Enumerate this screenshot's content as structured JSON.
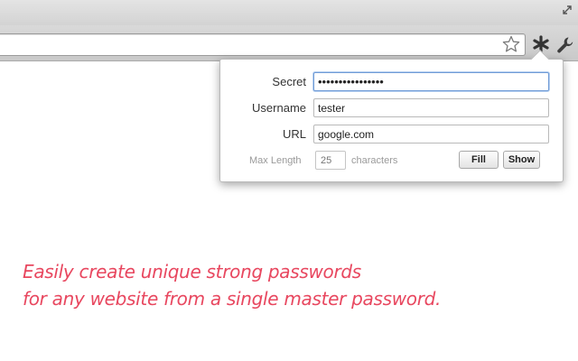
{
  "browser": {
    "address_value": "",
    "star_icon": "bookmark-star-icon",
    "extension_icon": "asterisk-extension-icon",
    "wrench_icon": "wrench-settings-icon",
    "resize_icon": "resize-diagonal-icon"
  },
  "popup": {
    "secret": {
      "label": "Secret",
      "value": "••••••••••••••••"
    },
    "username": {
      "label": "Username",
      "value": "tester"
    },
    "url": {
      "label": "URL",
      "value": "google.com"
    },
    "max_length": {
      "label": "Max Length",
      "placeholder": "25",
      "suffix": "characters"
    },
    "buttons": {
      "fill": "Fill",
      "show": "Show"
    }
  },
  "tagline": {
    "line1": "Easily create unique strong passwords",
    "line2": "for any website from a single master password."
  },
  "colors": {
    "tagline": "#e8475f",
    "focus_border": "#6f9bd6",
    "toolbar": "#d0d0d0"
  }
}
